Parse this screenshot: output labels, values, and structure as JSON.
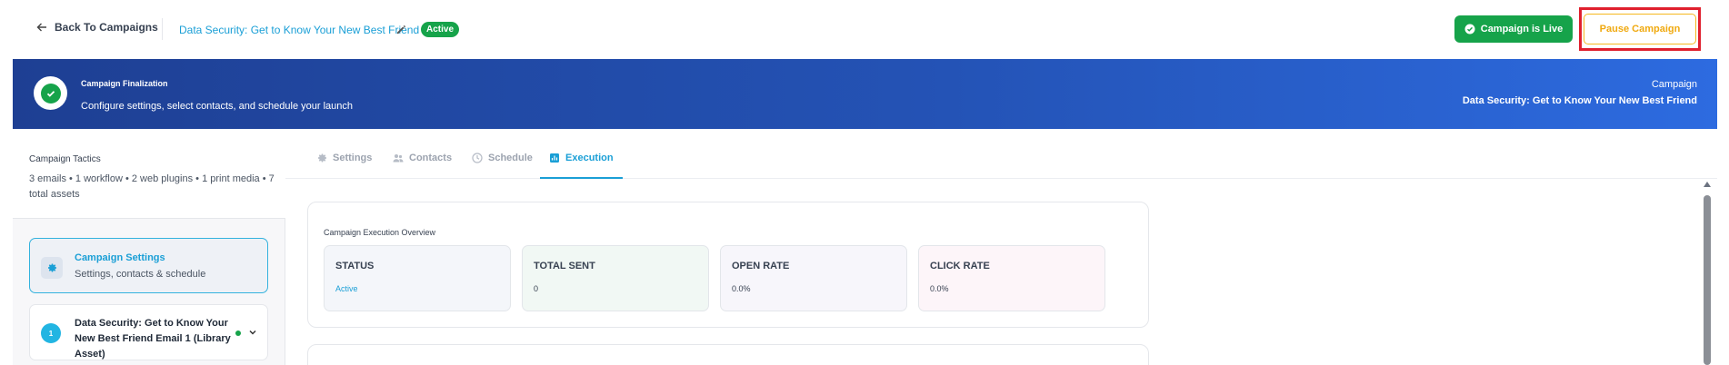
{
  "header": {
    "back_label": "Back To Campaigns",
    "campaign_title": "Data Security: Get to Know Your New Best Friend",
    "status_pill": "Active",
    "live_label": "Campaign is Live",
    "pause_label": "Pause Campaign"
  },
  "banner": {
    "kicker": "Campaign Finalization",
    "subtitle": "Configure settings, select contacts, and schedule your launch",
    "right_label": "Campaign",
    "right_value": "Data Security: Get to Know Your New Best Friend"
  },
  "sidebar": {
    "tactics_title": "Campaign Tactics",
    "tactics_summary": "3 emails • 1 workflow • 2 web plugins • 1 print media • 7 total assets",
    "settings_card": {
      "title": "Campaign Settings",
      "description": "Settings, contacts & schedule"
    },
    "email_card": {
      "number": "1",
      "title": "Data Security: Get to Know Your New Best Friend Email 1 (Library Asset)"
    }
  },
  "tabs": [
    {
      "label": "Settings",
      "icon": "gear-icon"
    },
    {
      "label": "Contacts",
      "icon": "users-icon"
    },
    {
      "label": "Schedule",
      "icon": "clock-icon"
    },
    {
      "label": "Execution",
      "icon": "chart-icon",
      "active": true
    }
  ],
  "overview": {
    "title": "Campaign Execution Overview",
    "stats": [
      {
        "label": "STATUS",
        "value": "Active",
        "bg": "#f4f6fa"
      },
      {
        "label": "TOTAL SENT",
        "value": "0",
        "bg": "#f1f8f4"
      },
      {
        "label": "OPEN RATE",
        "value": "0.0%",
        "bg": "#f7f6fb"
      },
      {
        "label": "CLICK RATE",
        "value": "0.0%",
        "bg": "#fdf5f9"
      }
    ]
  },
  "colors": {
    "accent": "#1a9fd6",
    "success": "#16a34a",
    "warning": "#f0a90f",
    "highlight": "#e0202e"
  }
}
